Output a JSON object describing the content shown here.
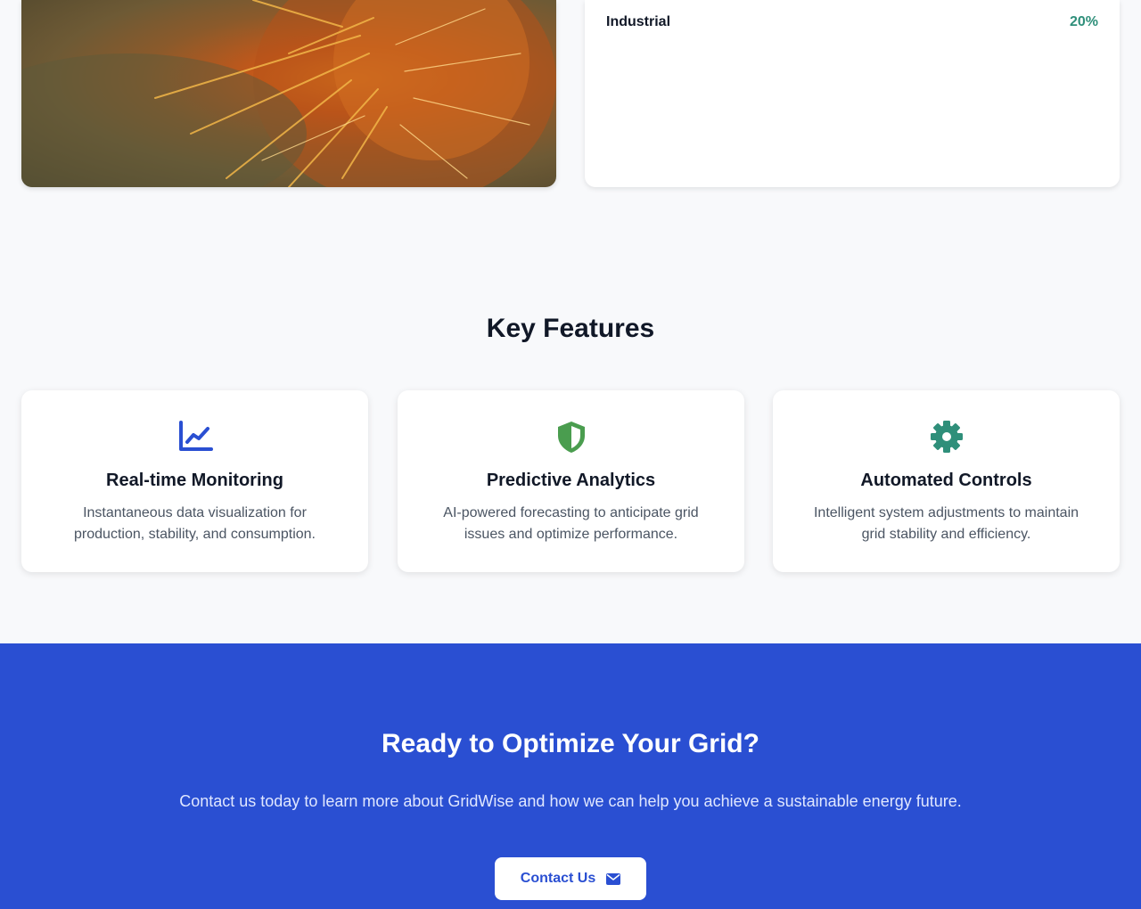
{
  "stats": {
    "rows": [
      {
        "label": "Industrial",
        "value": "20%"
      }
    ]
  },
  "features": {
    "title": "Key Features",
    "cards": [
      {
        "icon": "chart-line-icon",
        "title": "Real-time Monitoring",
        "description": "Instantaneous data visualization for production, stability, and consumption."
      },
      {
        "icon": "shield-icon",
        "title": "Predictive Analytics",
        "description": "AI-powered forecasting to anticipate grid issues and optimize performance."
      },
      {
        "icon": "gear-icon",
        "title": "Automated Controls",
        "description": "Intelligent system adjustments to maintain grid stability and efficiency."
      }
    ]
  },
  "cta": {
    "title": "Ready to Optimize Your Grid?",
    "text": "Contact us today to learn more about GridWise and how we can help you achieve a sustainable energy future.",
    "button_label": "Contact Us",
    "button_icon": "envelope-icon"
  },
  "colors": {
    "primary": "#2a4fd2",
    "accent_green": "#2f8f7a",
    "shield_green": "#4a9d4f",
    "background": "#f8f9fb"
  }
}
